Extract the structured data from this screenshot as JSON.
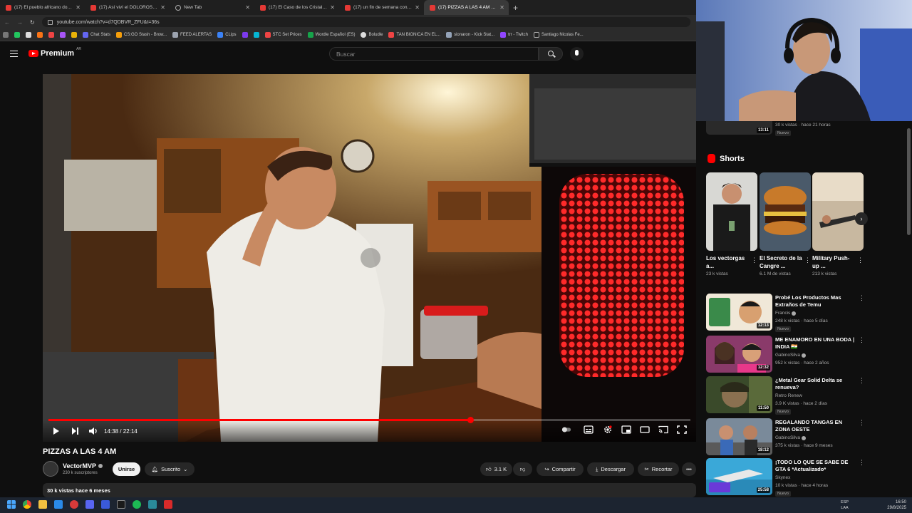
{
  "tabs": [
    {
      "title": "(17) El pueblo africano donde ...",
      "active": false
    },
    {
      "title": "(17) Así viví el DOLOROSO RITU...",
      "active": false
    },
    {
      "title": "New Tab",
      "active": false
    },
    {
      "title": "(17) El Caso de los Cristales de...",
      "active": false
    },
    {
      "title": "(17) un fin de semana con mis...",
      "active": false
    },
    {
      "title": "(17) PIZZAS A LAS 4 AM - Y...",
      "active": true
    }
  ],
  "address": {
    "url": "youtube.com/watch?v=d7QDBVR_ZFU&t=36s"
  },
  "bookmarks": [
    "Chat Stats",
    "CS:GO Stash - Brow...",
    "FEED ALERTAS",
    "CLips",
    "STC Set Prices",
    "Wordle Español (ES)",
    "Boludle",
    "TAN BIONICA EN EL...",
    "sionaron - Kick Stat...",
    "trr - Twitch",
    "Santiago Nicolas Fe..."
  ],
  "header": {
    "logo_text": "Premium",
    "country": "AR",
    "search_placeholder": "Buscar"
  },
  "player": {
    "current_time": "14:38",
    "duration": "22:14",
    "progress": 0.658
  },
  "video": {
    "title": "PIZZAS A LAS 4 AM",
    "channel": "VectorMVP",
    "subscribers": "230 k suscriptores",
    "join_label": "Unirse",
    "subscribed_label": "Suscrito",
    "likes": "3.1 K",
    "share_label": "Compartir",
    "download_label": "Descargar",
    "clip_label": "Recortar",
    "more": "•••",
    "meta": "30 k vistas  hace 6 meses"
  },
  "top_card": {
    "duration": "13:11",
    "meta": "30 k vistas · hace 21 horas",
    "badge": "Nuevo"
  },
  "shorts": {
    "heading": "Shorts",
    "items": [
      {
        "title": "Los vectorgas a...",
        "views": "23 k vistas"
      },
      {
        "title": "El Secreto de la Cangre ...",
        "views": "6.1 M de vistas"
      },
      {
        "title": "Military Push-up ...",
        "views": "213 k vistas"
      }
    ]
  },
  "recommendations": [
    {
      "title": "Probé Los Productos Mas Extraños de Temu",
      "channel": "Francis",
      "views": "248 k vistas · hace 5 días",
      "duration": "12:13",
      "badge": "Nuevo"
    },
    {
      "title": "ME ENAMORO EN UNA BODA | INDIA 🇮🇳",
      "channel": "GabinoSilva",
      "views": "952 k vistas · hace 2 años",
      "duration": "12:32",
      "badge": ""
    },
    {
      "title": "¿Metal Gear Solid Delta se renueva?",
      "channel": "Retro Renew",
      "views": "3.9 K vistas · hace 2 días",
      "duration": "11:50",
      "badge": "Nuevo"
    },
    {
      "title": "REGALANDO TANGAS EN ZONA OESTE",
      "channel": "GabinoSilva",
      "views": "375 k vistas · hace 9 meses",
      "duration": "18:12",
      "badge": ""
    },
    {
      "title": "¡TODO LO QUE SE SABE DE GTA 6 *Actualizado*",
      "channel": "Skynex",
      "views": "10 k vistas · hace 4 horas",
      "duration": "25:58",
      "badge": "Nuevo"
    }
  ],
  "taskbar": {
    "lang_top": "ESP",
    "lang_bottom": "LAA",
    "time": "16:50",
    "date": "29/8/2025"
  }
}
